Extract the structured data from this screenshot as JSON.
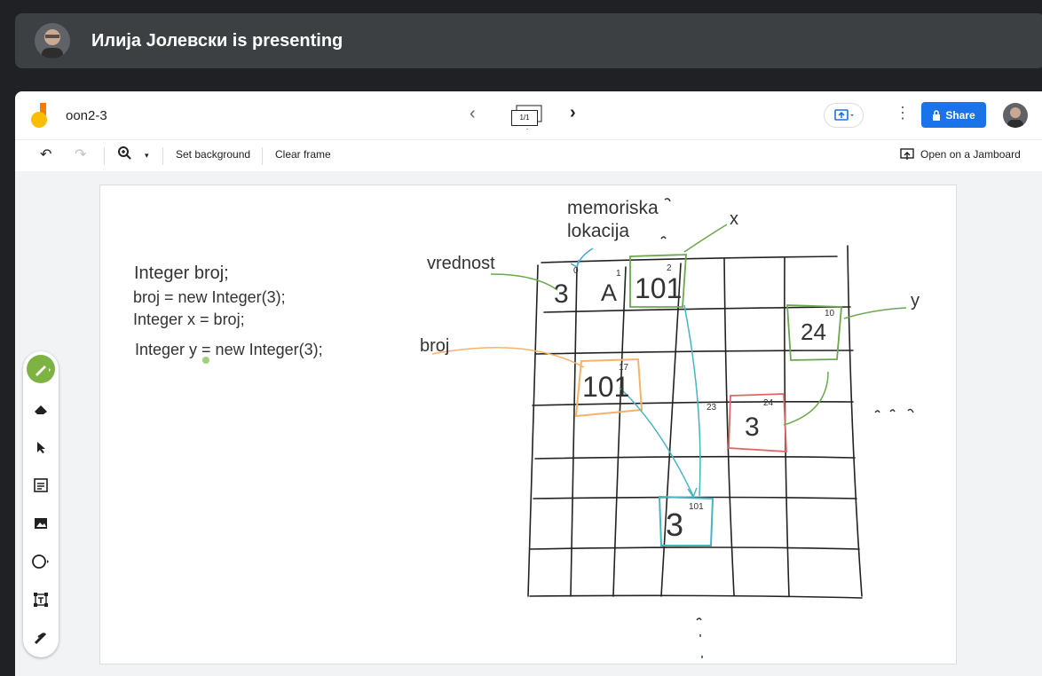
{
  "presenter": {
    "name": "Илија Јолевски is presenting"
  },
  "doc": {
    "title": "oon2-3"
  },
  "nav": {
    "frame_counter": "1/1"
  },
  "topbar": {
    "share_label": "Share"
  },
  "toolbar": {
    "set_background": "Set background",
    "clear_frame": "Clear frame",
    "open_jamboard": "Open on a Jamboard"
  },
  "board": {
    "code": [
      "Integer broj;",
      "broj = new Integer(3);",
      "Integer x = broj;",
      "Integer y = new Integer(3);"
    ],
    "labels": {
      "memoriska": "memoriska",
      "lokacija": "lokacija",
      "vrednost": "vrednost",
      "broj": "broj",
      "x": "x",
      "y": "y"
    },
    "cells": {
      "c0": "3",
      "c1": "A",
      "c2": "101",
      "c17": "101",
      "c10": "24",
      "c24": "3",
      "c101": "3"
    },
    "indices": {
      "i0": "0",
      "i1": "1",
      "i2": "2",
      "i10": "10",
      "i17": "17",
      "i23": "23",
      "i24": "24",
      "i101": "101"
    }
  }
}
